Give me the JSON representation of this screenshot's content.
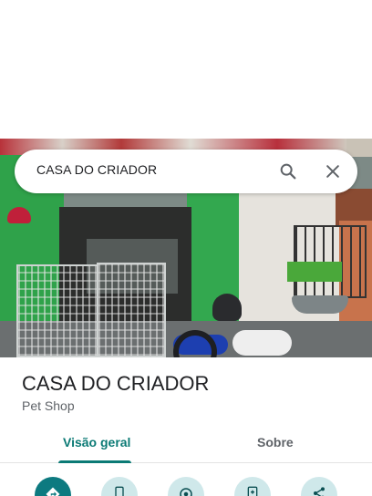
{
  "search": {
    "query": "CASA DO CRIADOR",
    "search_icon": "search-icon",
    "clear_icon": "close-icon"
  },
  "place": {
    "name": "CASA DO CRIADOR",
    "category": "Pet Shop"
  },
  "tabs": [
    {
      "label": "Visão geral",
      "selected": true
    },
    {
      "label": "Sobre",
      "selected": false
    }
  ],
  "actions": [
    {
      "icon": "directions-icon",
      "primary": true
    },
    {
      "icon": "phone-icon",
      "primary": false
    },
    {
      "icon": "location-icon",
      "primary": false
    },
    {
      "icon": "save-icon",
      "primary": false
    },
    {
      "icon": "share-icon",
      "primary": false
    }
  ],
  "colors": {
    "accent": "#0b7a75",
    "action_primary": "#0d7a80",
    "action_secondary": "#cfe8ea"
  }
}
